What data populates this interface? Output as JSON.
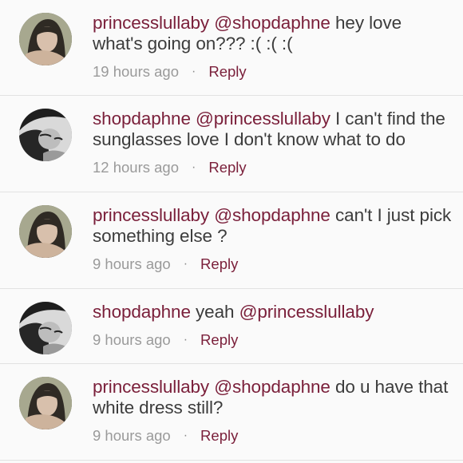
{
  "comments": [
    {
      "avatar": "avatar-princesslullaby",
      "user": "princesslullaby",
      "mention": "@shopdaphne",
      "text": " hey love what's going on??? :( :( :(",
      "mention_after": "",
      "text_after": "",
      "time": "19 hours ago",
      "reply": "Reply"
    },
    {
      "avatar": "avatar-shopdaphne",
      "user": "shopdaphne",
      "mention": "@princesslullaby",
      "text": " I can't find the sunglasses love I don't know what to do",
      "mention_after": "",
      "text_after": "",
      "time": "12 hours ago",
      "reply": "Reply"
    },
    {
      "avatar": "avatar-princesslullaby",
      "user": "princesslullaby",
      "mention": "@shopdaphne",
      "text": " can't I just pick something else ?",
      "mention_after": "",
      "text_after": "",
      "time": "9 hours ago",
      "reply": "Reply"
    },
    {
      "avatar": "avatar-shopdaphne",
      "user": "shopdaphne",
      "mention": "",
      "text": " yeah ",
      "mention_after": "@princesslullaby",
      "text_after": "",
      "time": "9 hours ago",
      "reply": "Reply"
    },
    {
      "avatar": "avatar-princesslullaby",
      "user": "princesslullaby",
      "mention": "@shopdaphne",
      "text": " do u have that white dress still?",
      "mention_after": "",
      "text_after": "",
      "time": "9 hours ago",
      "reply": "Reply"
    }
  ],
  "separator": "·",
  "colors": {
    "link": "#7a1f3a",
    "text": "#3c3c3c",
    "muted": "#9a9a9a",
    "background": "#fafafa"
  }
}
